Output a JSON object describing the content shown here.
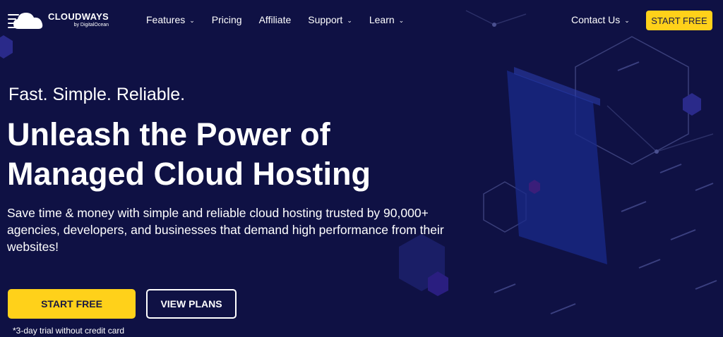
{
  "brand": {
    "name": "CLOUDWAYS",
    "sub": "by DigitalOcean",
    "logo_icon": "cloud-icon"
  },
  "nav": {
    "items": [
      {
        "label": "Features",
        "dropdown": true
      },
      {
        "label": "Pricing",
        "dropdown": false
      },
      {
        "label": "Affiliate",
        "dropdown": false
      },
      {
        "label": "Support",
        "dropdown": true
      },
      {
        "label": "Learn",
        "dropdown": true
      }
    ],
    "contact_label": "Contact Us",
    "cta_label": "START FREE"
  },
  "hero": {
    "tagline": "Fast. Simple. Reliable.",
    "headline_line1": "Unleash the Power of",
    "headline_line2": "Managed Cloud Hosting",
    "description": "Save time & money with simple and reliable cloud hosting trusted by 90,000+ agencies, developers, and businesses that demand high performance from their websites!",
    "primary_cta": "START FREE",
    "secondary_cta": "VIEW PLANS",
    "note": "*3-day trial without credit card"
  },
  "colors": {
    "background": "#0f1144",
    "accent": "#ffd11a",
    "text": "#ffffff"
  }
}
